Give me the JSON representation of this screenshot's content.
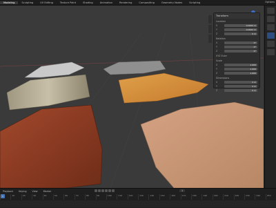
{
  "workspace_tabs": [
    "Modeling",
    "Sculpting",
    "UV Editing",
    "Texture Paint",
    "Shading",
    "Animation",
    "Rendering",
    "Compositing",
    "Geometry Nodes",
    "Scripting"
  ],
  "scene_label": "Options",
  "npanel": {
    "header": "Transform",
    "sections": [
      {
        "title": "Location",
        "rows": [
          {
            "label": "X",
            "value": "0.0000 m"
          },
          {
            "label": "Y",
            "value": "0.0000 m"
          },
          {
            "label": "Z",
            "value": "0 m"
          }
        ]
      },
      {
        "title": "Rotation",
        "rows": [
          {
            "label": "X",
            "value": "0°"
          },
          {
            "label": "Y",
            "value": "0°"
          },
          {
            "label": "Z",
            "value": "0°"
          }
        ]
      },
      {
        "title": "XYZ Euler",
        "rows": []
      },
      {
        "title": "Scale",
        "rows": [
          {
            "label": "X",
            "value": "1.000"
          },
          {
            "label": "Y",
            "value": "1.000"
          },
          {
            "label": "Z",
            "value": "1.000"
          }
        ]
      },
      {
        "title": "Dimensions",
        "rows": [
          {
            "label": "X",
            "value": "2 m"
          },
          {
            "label": "Y",
            "value": "2 m"
          },
          {
            "label": "Z",
            "value": "0 m"
          }
        ]
      }
    ]
  },
  "timeline": {
    "menus": [
      "Playback",
      "Keying",
      "View",
      "Marker"
    ],
    "current_frame": "1",
    "ruler": [
      "0",
      "10",
      "20",
      "30",
      "40",
      "50",
      "60",
      "70",
      "80",
      "90",
      "100",
      "110",
      "120",
      "130",
      "140",
      "150",
      "160",
      "170",
      "180",
      "190",
      "200",
      "210",
      "220",
      "230",
      "240",
      "250"
    ]
  },
  "colors": {
    "accent": "#4772b3",
    "viewport_bg": "#3a3a3a"
  }
}
